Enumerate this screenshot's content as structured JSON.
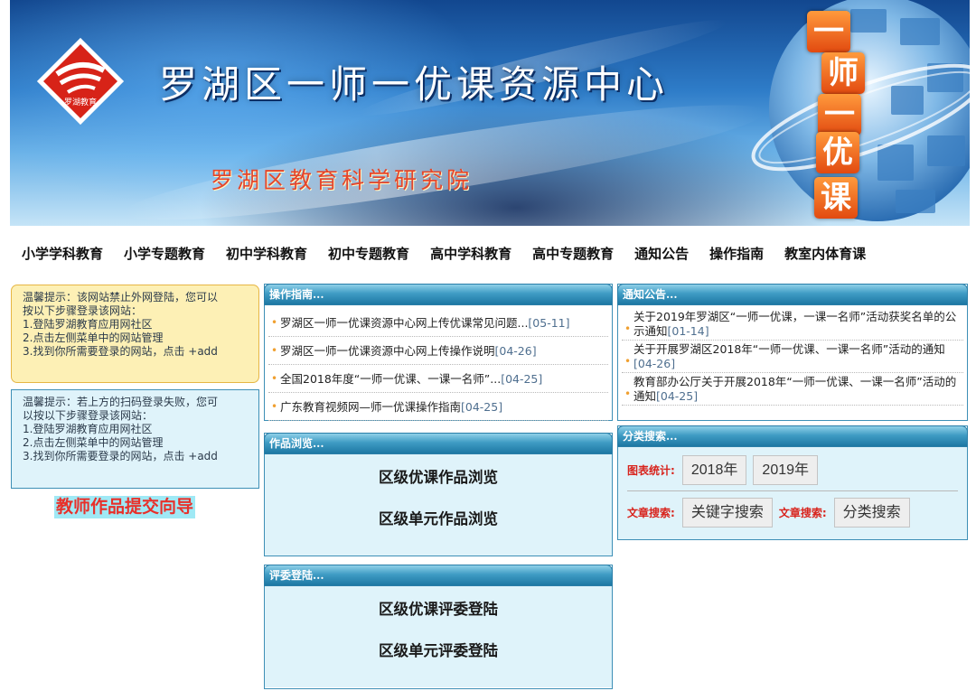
{
  "banner": {
    "title": "罗湖区一师一优课资源中心",
    "subtitle": "罗湖区教育科学研究院",
    "logo_text": "罗湖教育",
    "globe_chars": [
      "一",
      "师",
      "一",
      "优",
      "课"
    ]
  },
  "nav": [
    "小学学科教育",
    "小学专题教育",
    "初中学科教育",
    "初中专题教育",
    "高中学科教育",
    "高中专题教育",
    "通知公告",
    "操作指南",
    "教室内体育课"
  ],
  "tips": {
    "tip1": [
      "温馨提示：该网站禁止外网登陆，您可以",
      "按以下步骤登录该网站：",
      "1.登陆罗湖教育应用网社区",
      "2.点击左侧菜单中的网站管理",
      "3.找到你所需要登录的网站，点击 +add"
    ],
    "tip2": [
      "温馨提示：若上方的扫码登录失败，您可",
      "以按以下步骤登录该网站：",
      "1.登陆罗湖教育应用网社区",
      "2.点击左侧菜单中的网站管理",
      "3.找到你所需要登录的网站，点击 +add"
    ],
    "submit_guide": "教师作品提交向导"
  },
  "guide_panel": {
    "title": "操作指南...",
    "items": [
      {
        "text": "罗湖区一师一优课资源中心网上传优课常见问题...",
        "date": "[05-11]"
      },
      {
        "text": "罗湖区一师一优课资源中心网上传操作说明",
        "date": "[04-26]"
      },
      {
        "text": "全国2018年度“一师一优课、一课一名师”...",
        "date": "[04-25]"
      },
      {
        "text": "广东教育视频网—师一优课操作指南",
        "date": "[04-25]"
      }
    ]
  },
  "notice_panel": {
    "title": "通知公告...",
    "items": [
      {
        "text": "关于2019年罗湖区“一师一优课，一课一名师”活动获奖名单的公示通知",
        "date": "[01-14]"
      },
      {
        "text": "关于开展罗湖区2018年“一师一优课、一课一名师”活动的通知",
        "date": "[04-26]"
      },
      {
        "text": "教育部办公厅关于开展2018年“一师一优课、一课一名师”活动的通知",
        "date": "[04-25]"
      }
    ]
  },
  "browse_panel": {
    "title": "作品浏览...",
    "links": [
      "区级优课作品浏览",
      "区级单元作品浏览"
    ]
  },
  "judge_panel": {
    "title": "评委登陆...",
    "links": [
      "区级优课评委登陆",
      "区级单元评委登陆"
    ]
  },
  "search_panel": {
    "title": "分类搜索...",
    "stats_label": "图表统计:",
    "stats_buttons": [
      "2018年",
      "2019年"
    ],
    "article_label_1": "文章搜索:",
    "keyword_button": "关键字搜索",
    "article_label_2": "文章搜索:",
    "category_button": "分类搜索"
  },
  "colors": {
    "panel_header": "#3f9cc4",
    "panel_body": "#dff3fa",
    "tip_yellow": "#fdf0b5",
    "accent_red": "#e8302a",
    "date_color": "#4f6f8f"
  }
}
